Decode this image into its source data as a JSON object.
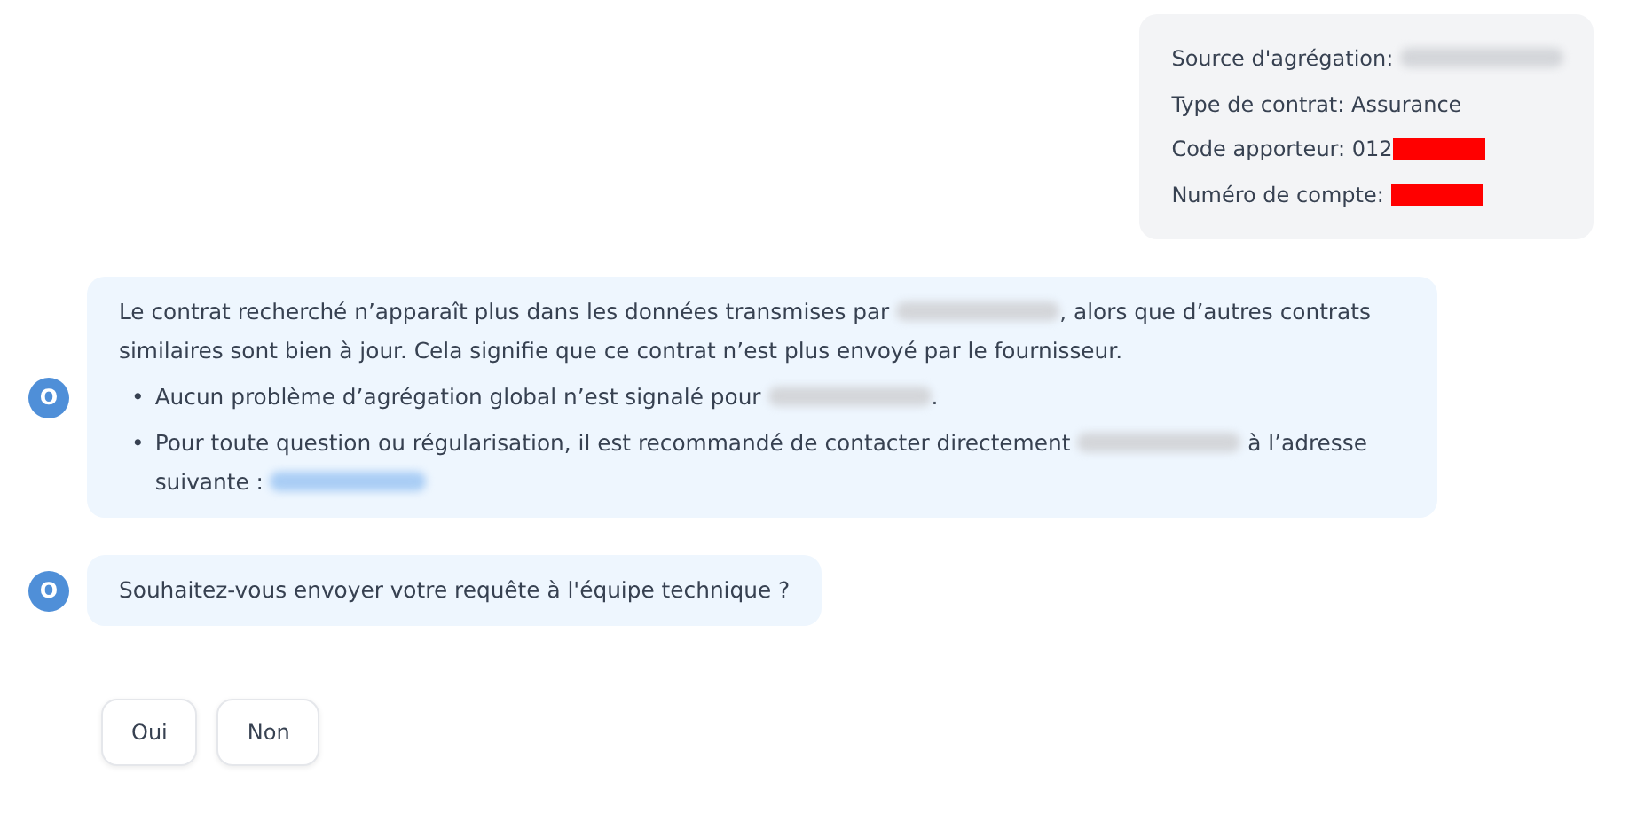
{
  "user_message": {
    "lines": [
      {
        "parts": [
          {
            "kind": "text",
            "text": "Source d'agrégation: "
          },
          {
            "kind": "blurred"
          }
        ]
      },
      {
        "parts": [
          {
            "kind": "text",
            "text": "Type de contrat: Assurance"
          }
        ]
      },
      {
        "parts": [
          {
            "kind": "text",
            "text": "Code apporteur: 012"
          },
          {
            "kind": "redacted"
          }
        ]
      },
      {
        "parts": [
          {
            "kind": "text",
            "text": "Numéro de compte: "
          },
          {
            "kind": "redacted"
          }
        ]
      }
    ]
  },
  "assistant_messages": [
    {
      "avatar": "O",
      "paragraphs": [
        {
          "parts": [
            {
              "kind": "text",
              "text": "Le contrat recherché n’apparaît plus dans les données transmises par "
            },
            {
              "kind": "blurred"
            },
            {
              "kind": "text",
              "text": ", alors que d’autres contrats similaires sont bien à jour. Cela signifie que ce contrat n’est plus envoyé par le fournisseur."
            }
          ]
        }
      ],
      "bullets": [
        {
          "marker": "•",
          "parts": [
            {
              "kind": "text",
              "text": "Aucun problème d’agrégation global n’est signalé pour "
            },
            {
              "kind": "blurred"
            },
            {
              "kind": "text",
              "text": "."
            }
          ]
        },
        {
          "marker": "•",
          "parts": [
            {
              "kind": "text",
              "text": "Pour toute question ou régularisation, il est recommandé de contacter directement "
            },
            {
              "kind": "blurred"
            },
            {
              "kind": "text",
              "text": " à l’adresse suivante : "
            },
            {
              "kind": "blurred-link"
            }
          ]
        }
      ]
    },
    {
      "avatar": "O",
      "paragraphs": [
        {
          "parts": [
            {
              "kind": "text",
              "text": "Souhaitez-vous envoyer votre requête à l'équipe technique ?"
            }
          ]
        }
      ]
    }
  ],
  "quick_replies": [
    "Oui",
    "Non"
  ]
}
